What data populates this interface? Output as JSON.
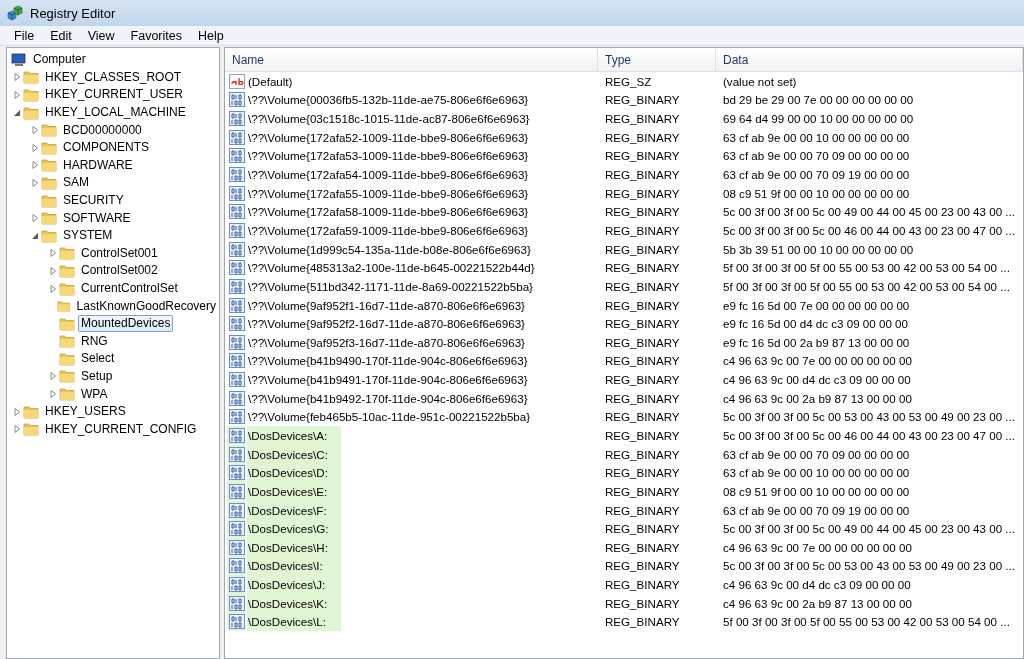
{
  "window": {
    "title": "Registry Editor"
  },
  "menu": [
    "File",
    "Edit",
    "View",
    "Favorites",
    "Help"
  ],
  "tree": {
    "label": "Computer",
    "children": [
      {
        "kind": "branch",
        "label": "HKEY_CLASSES_ROOT",
        "expanded": false,
        "selected": false
      },
      {
        "kind": "branch",
        "label": "HKEY_CURRENT_USER",
        "expanded": false,
        "selected": false
      },
      {
        "kind": "branch",
        "label": "HKEY_LOCAL_MACHINE",
        "expanded": true,
        "selected": false,
        "children": [
          {
            "kind": "branch",
            "label": "BCD00000000",
            "expanded": false,
            "selected": false
          },
          {
            "kind": "branch",
            "label": "COMPONENTS",
            "expanded": false,
            "selected": false
          },
          {
            "kind": "branch",
            "label": "HARDWARE",
            "expanded": false,
            "selected": false
          },
          {
            "kind": "branch",
            "label": "SAM",
            "expanded": false,
            "selected": false
          },
          {
            "kind": "leaf",
            "label": "SECURITY",
            "selected": false
          },
          {
            "kind": "branch",
            "label": "SOFTWARE",
            "expanded": false,
            "selected": false
          },
          {
            "kind": "branch",
            "label": "SYSTEM",
            "expanded": true,
            "selected": false,
            "children": [
              {
                "kind": "branch",
                "label": "ControlSet001",
                "expanded": false,
                "selected": false
              },
              {
                "kind": "branch",
                "label": "ControlSet002",
                "expanded": false,
                "selected": false
              },
              {
                "kind": "branch",
                "label": "CurrentControlSet",
                "expanded": false,
                "selected": false
              },
              {
                "kind": "leaf",
                "label": "LastKnownGoodRecovery",
                "selected": false
              },
              {
                "kind": "leaf",
                "label": "MountedDevices",
                "selected": true
              },
              {
                "kind": "leaf",
                "label": "RNG",
                "selected": false
              },
              {
                "kind": "leaf",
                "label": "Select",
                "selected": false
              },
              {
                "kind": "branch",
                "label": "Setup",
                "expanded": false,
                "selected": false
              },
              {
                "kind": "branch",
                "label": "WPA",
                "expanded": false,
                "selected": false
              }
            ]
          }
        ]
      },
      {
        "kind": "branch",
        "label": "HKEY_USERS",
        "expanded": false,
        "selected": false
      },
      {
        "kind": "branch",
        "label": "HKEY_CURRENT_CONFIG",
        "expanded": false,
        "selected": false
      }
    ]
  },
  "table": {
    "columns": [
      "Name",
      "Type",
      "Data"
    ],
    "rows": [
      {
        "kind": "string",
        "name": "(Default)",
        "type": "REG_SZ",
        "data": "(value not set)",
        "highlighted": false
      },
      {
        "kind": "binary",
        "name": "\\??\\Volume{00036fb5-132b-11de-ae75-806e6f6e6963}",
        "type": "REG_BINARY",
        "data": "bd 29 be 29 00 7e 00 00 00 00 00 00",
        "highlighted": false
      },
      {
        "kind": "binary",
        "name": "\\??\\Volume{03c1518c-1015-11de-ac87-806e6f6e6963}",
        "type": "REG_BINARY",
        "data": "69 64 d4 99 00 00 10 00 00 00 00 00",
        "highlighted": false
      },
      {
        "kind": "binary",
        "name": "\\??\\Volume{172afa52-1009-11de-bbe9-806e6f6e6963}",
        "type": "REG_BINARY",
        "data": "63 cf ab 9e 00 00 10 00 00 00 00 00",
        "highlighted": false
      },
      {
        "kind": "binary",
        "name": "\\??\\Volume{172afa53-1009-11de-bbe9-806e6f6e6963}",
        "type": "REG_BINARY",
        "data": "63 cf ab 9e 00 00 70 09 00 00 00 00",
        "highlighted": false
      },
      {
        "kind": "binary",
        "name": "\\??\\Volume{172afa54-1009-11de-bbe9-806e6f6e6963}",
        "type": "REG_BINARY",
        "data": "63 cf ab 9e 00 00 70 09 19 00 00 00",
        "highlighted": false
      },
      {
        "kind": "binary",
        "name": "\\??\\Volume{172afa55-1009-11de-bbe9-806e6f6e6963}",
        "type": "REG_BINARY",
        "data": "08 c9 51 9f 00 00 10 00 00 00 00 00",
        "highlighted": false
      },
      {
        "kind": "binary",
        "name": "\\??\\Volume{172afa58-1009-11de-bbe9-806e6f6e6963}",
        "type": "REG_BINARY",
        "data": "5c 00 3f 00 3f 00 5c 00 49 00 44 00 45 00 23 00 43 00 ...",
        "highlighted": false
      },
      {
        "kind": "binary",
        "name": "\\??\\Volume{172afa59-1009-11de-bbe9-806e6f6e6963}",
        "type": "REG_BINARY",
        "data": "5c 00 3f 00 3f 00 5c 00 46 00 44 00 43 00 23 00 47 00 ...",
        "highlighted": false
      },
      {
        "kind": "binary",
        "name": "\\??\\Volume{1d999c54-135a-11de-b08e-806e6f6e6963}",
        "type": "REG_BINARY",
        "data": "5b 3b 39 51 00 00 10 00 00 00 00 00",
        "highlighted": false
      },
      {
        "kind": "binary",
        "name": "\\??\\Volume{485313a2-100e-11de-b645-00221522b44d}",
        "type": "REG_BINARY",
        "data": "5f 00 3f 00 3f 00 5f 00 55 00 53 00 42 00 53 00 54 00 ...",
        "highlighted": false
      },
      {
        "kind": "binary",
        "name": "\\??\\Volume{511bd342-1171-11de-8a69-00221522b5ba}",
        "type": "REG_BINARY",
        "data": "5f 00 3f 00 3f 00 5f 00 55 00 53 00 42 00 53 00 54 00 ...",
        "highlighted": false
      },
      {
        "kind": "binary",
        "name": "\\??\\Volume{9af952f1-16d7-11de-a870-806e6f6e6963}",
        "type": "REG_BINARY",
        "data": "e9 fc 16 5d 00 7e 00 00 00 00 00 00",
        "highlighted": false
      },
      {
        "kind": "binary",
        "name": "\\??\\Volume{9af952f2-16d7-11de-a870-806e6f6e6963}",
        "type": "REG_BINARY",
        "data": "e9 fc 16 5d 00 d4 dc c3 09 00 00 00",
        "highlighted": false
      },
      {
        "kind": "binary",
        "name": "\\??\\Volume{9af952f3-16d7-11de-a870-806e6f6e6963}",
        "type": "REG_BINARY",
        "data": "e9 fc 16 5d 00 2a b9 87 13 00 00 00",
        "highlighted": false
      },
      {
        "kind": "binary",
        "name": "\\??\\Volume{b41b9490-170f-11de-904c-806e6f6e6963}",
        "type": "REG_BINARY",
        "data": "c4 96 63 9c 00 7e 00 00 00 00 00 00",
        "highlighted": false
      },
      {
        "kind": "binary",
        "name": "\\??\\Volume{b41b9491-170f-11de-904c-806e6f6e6963}",
        "type": "REG_BINARY",
        "data": "c4 96 63 9c 00 d4 dc c3 09 00 00 00",
        "highlighted": false
      },
      {
        "kind": "binary",
        "name": "\\??\\Volume{b41b9492-170f-11de-904c-806e6f6e6963}",
        "type": "REG_BINARY",
        "data": "c4 96 63 9c 00 2a b9 87 13 00 00 00",
        "highlighted": false
      },
      {
        "kind": "binary",
        "name": "\\??\\Volume{feb465b5-10ac-11de-951c-00221522b5ba}",
        "type": "REG_BINARY",
        "data": "5c 00 3f 00 3f 00 5c 00 53 00 43 00 53 00 49 00 23 00 ...",
        "highlighted": false
      },
      {
        "kind": "binary",
        "name": "\\DosDevices\\A:",
        "type": "REG_BINARY",
        "data": "5c 00 3f 00 3f 00 5c 00 46 00 44 00 43 00 23 00 47 00 ...",
        "highlighted": true
      },
      {
        "kind": "binary",
        "name": "\\DosDevices\\C:",
        "type": "REG_BINARY",
        "data": "63 cf ab 9e 00 00 70 09 00 00 00 00",
        "highlighted": true
      },
      {
        "kind": "binary",
        "name": "\\DosDevices\\D:",
        "type": "REG_BINARY",
        "data": "63 cf ab 9e 00 00 10 00 00 00 00 00",
        "highlighted": true
      },
      {
        "kind": "binary",
        "name": "\\DosDevices\\E:",
        "type": "REG_BINARY",
        "data": "08 c9 51 9f 00 00 10 00 00 00 00 00",
        "highlighted": true
      },
      {
        "kind": "binary",
        "name": "\\DosDevices\\F:",
        "type": "REG_BINARY",
        "data": "63 cf ab 9e 00 00 70 09 19 00 00 00",
        "highlighted": true
      },
      {
        "kind": "binary",
        "name": "\\DosDevices\\G:",
        "type": "REG_BINARY",
        "data": "5c 00 3f 00 3f 00 5c 00 49 00 44 00 45 00 23 00 43 00 ...",
        "highlighted": true
      },
      {
        "kind": "binary",
        "name": "\\DosDevices\\H:",
        "type": "REG_BINARY",
        "data": "c4 96 63 9c 00 7e 00 00 00 00 00 00",
        "highlighted": true
      },
      {
        "kind": "binary",
        "name": "\\DosDevices\\I:",
        "type": "REG_BINARY",
        "data": "5c 00 3f 00 3f 00 5c 00 53 00 43 00 53 00 49 00 23 00 ...",
        "highlighted": true
      },
      {
        "kind": "binary",
        "name": "\\DosDevices\\J:",
        "type": "REG_BINARY",
        "data": "c4 96 63 9c 00 d4 dc c3 09 00 00 00",
        "highlighted": true
      },
      {
        "kind": "binary",
        "name": "\\DosDevices\\K:",
        "type": "REG_BINARY",
        "data": "c4 96 63 9c 00 2a b9 87 13 00 00 00",
        "highlighted": true
      },
      {
        "kind": "binary",
        "name": "\\DosDevices\\L:",
        "type": "REG_BINARY",
        "data": "5f 00 3f 00 3f 00 5f 00 55 00 53 00 42 00 53 00 54 00 ...",
        "highlighted": true
      }
    ]
  }
}
